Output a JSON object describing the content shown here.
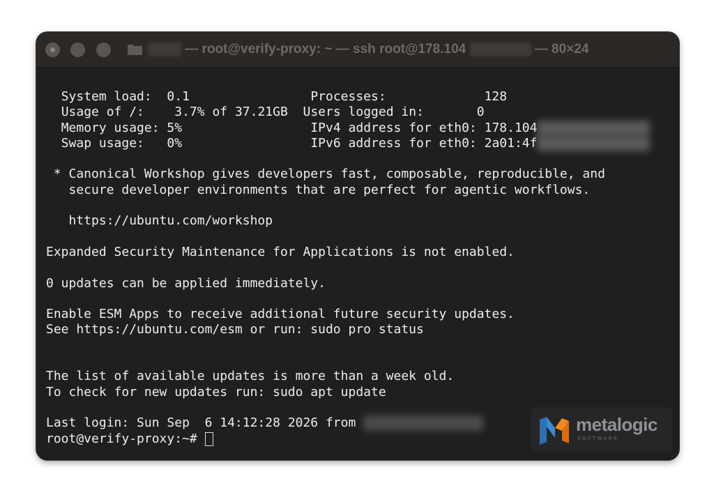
{
  "window": {
    "title_prefix": "— root@verify-proxy: ~ — ssh root@178.104",
    "title_suffix": "— 80×24"
  },
  "terminal": {
    "sysinfo": [
      {
        "label": "System load:",
        "value": "0.1",
        "label2": "Processes:",
        "value2": "128"
      },
      {
        "label": "Usage of /:",
        "value": "3.7% of 37.21GB",
        "label2": "Users logged in:",
        "value2": "0"
      },
      {
        "label": "Memory usage:",
        "value": "5%",
        "label2": "IPv4 address for eth0:",
        "value2": "178.104"
      },
      {
        "label": "Swap usage:",
        "value": "0%",
        "label2": "IPv6 address for eth0:",
        "value2": "2a01:4f"
      }
    ],
    "workshop_line1": " * Canonical Workshop gives developers fast, composable, reproducible, and",
    "workshop_line2": "   secure developer environments that are perfect for agentic workflows.",
    "workshop_url": "   https://ubuntu.com/workshop",
    "esm_notice": "Expanded Security Maintenance for Applications is not enabled.",
    "updates": "0 updates can be applied immediately.",
    "esm_enable1": "Enable ESM Apps to receive additional future security updates.",
    "esm_enable2": "See https://ubuntu.com/esm or run: sudo pro status",
    "stale1": "The list of available updates is more than a week old.",
    "stale2": "To check for new updates run: sudo apt update",
    "last_login": "Last login: Sun Sep  6 14:12:28 2026 from ",
    "prompt": "root@verify-proxy:~# "
  },
  "watermark": {
    "name": "metalogic",
    "sub": "SOFTWARE"
  }
}
